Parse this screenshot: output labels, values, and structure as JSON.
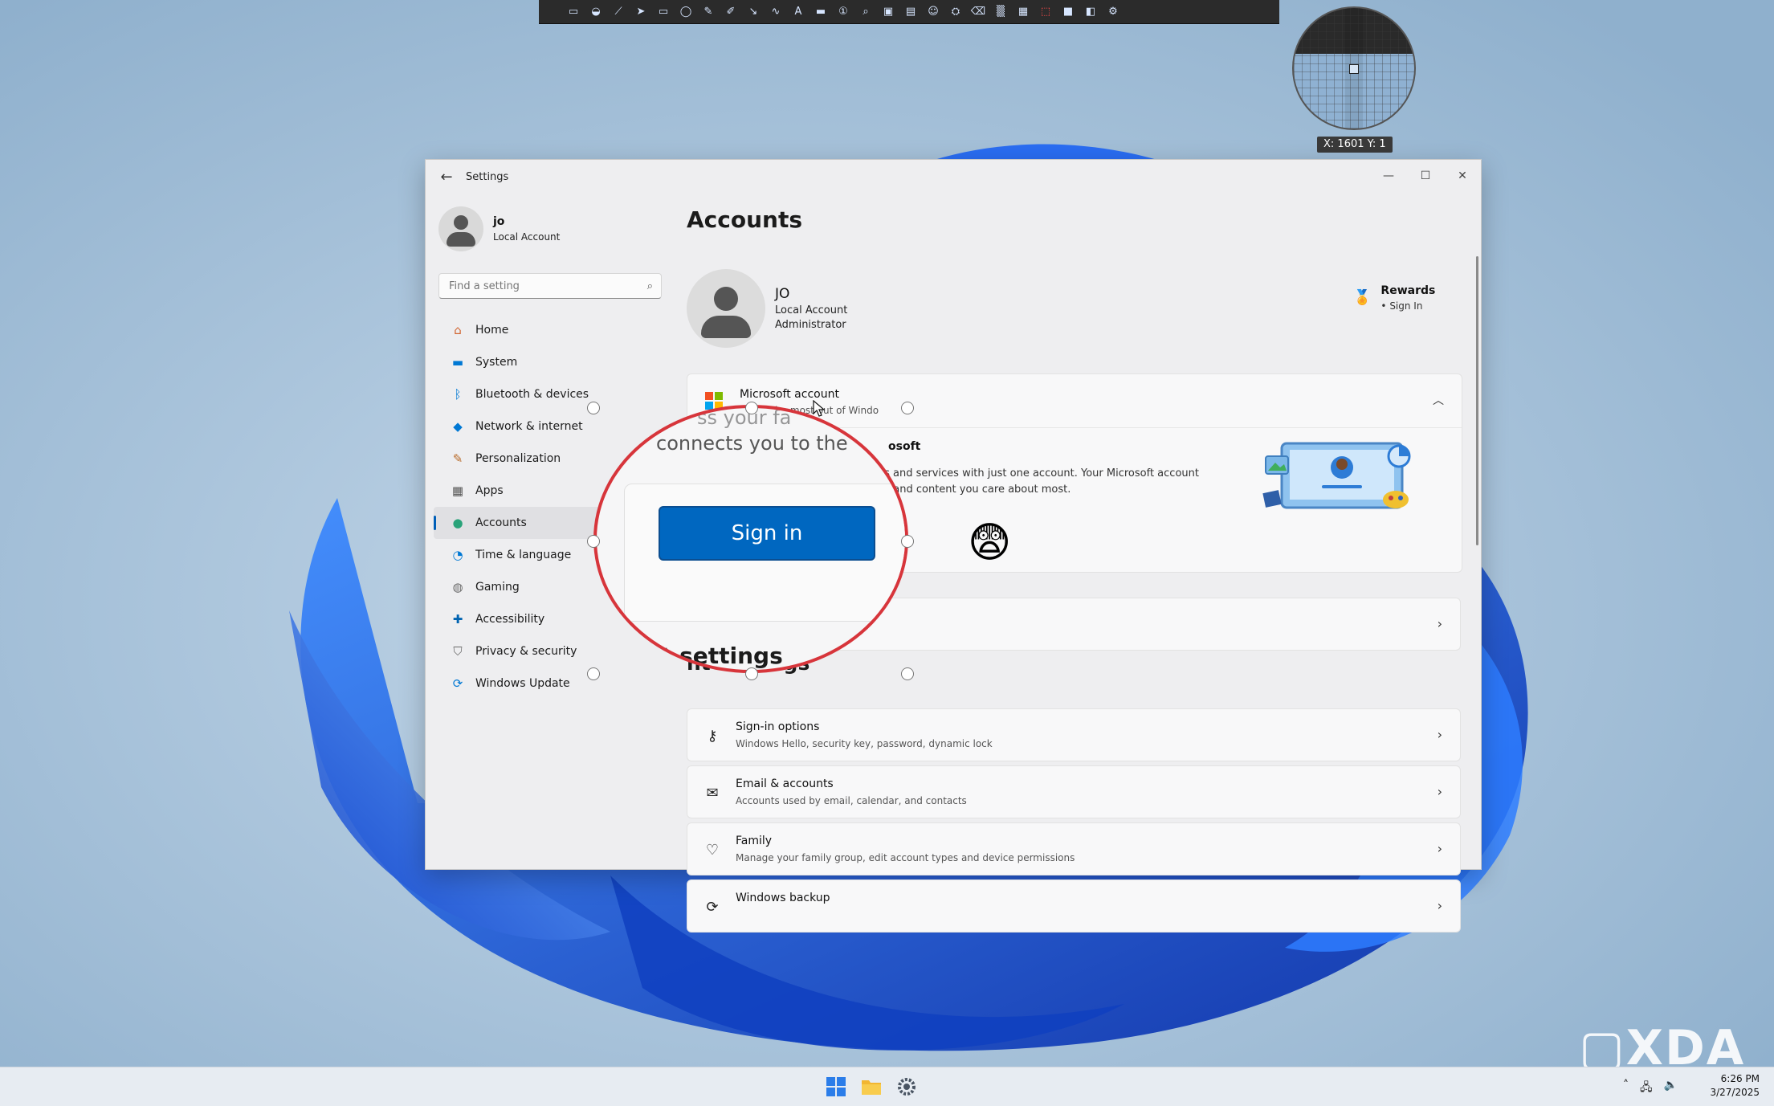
{
  "toolbar": {
    "icons": [
      "select",
      "shape",
      "line",
      "cursor",
      "rect",
      "ellipse",
      "pen",
      "marker",
      "arrow",
      "curve",
      "text",
      "callout",
      "counter",
      "magnifier",
      "note",
      "highlight",
      "emoji",
      "stamp",
      "eraser",
      "blur",
      "grid",
      "crop",
      "fill",
      "color",
      "settings"
    ]
  },
  "loupe": {
    "coordinates": "X: 1601 Y: 1"
  },
  "window": {
    "title": "Settings"
  },
  "profile": {
    "name": "jo",
    "type": "Local Account"
  },
  "search": {
    "placeholder": "Find a setting"
  },
  "nav": {
    "items": [
      {
        "label": "Home",
        "icon": "home-icon",
        "color": "#d1642f"
      },
      {
        "label": "System",
        "icon": "monitor-icon",
        "color": "#0078d4"
      },
      {
        "label": "Bluetooth & devices",
        "icon": "bluetooth-icon",
        "color": "#0078d4"
      },
      {
        "label": "Network & internet",
        "icon": "wifi-icon",
        "color": "#0078d4"
      },
      {
        "label": "Personalization",
        "icon": "brush-icon",
        "color": "#b86a28"
      },
      {
        "label": "Apps",
        "icon": "apps-icon",
        "color": "#555555"
      },
      {
        "label": "Accounts",
        "icon": "person-icon",
        "color": "#2aa37a"
      },
      {
        "label": "Time & language",
        "icon": "globe-clock-icon",
        "color": "#0078d4"
      },
      {
        "label": "Gaming",
        "icon": "controller-icon",
        "color": "#6b6b6b"
      },
      {
        "label": "Accessibility",
        "icon": "accessibility-icon",
        "color": "#0063b1"
      },
      {
        "label": "Privacy & security",
        "icon": "shield-icon",
        "color": "#6b6b6b"
      },
      {
        "label": "Windows Update",
        "icon": "update-icon",
        "color": "#0078d4"
      }
    ],
    "active": "Accounts"
  },
  "main": {
    "title": "Accounts",
    "account": {
      "name": "JO",
      "line1": "Local Account",
      "line2": "Administrator"
    },
    "rewards": {
      "title": "Rewards",
      "sub": "• Sign In"
    },
    "microsoft_account": {
      "title": "Microsoft account",
      "sub_visible": "to get the most out of Windo",
      "body_title_visible": "osoft",
      "body_line1": "ts and services with just one account. Your Microsoft account",
      "body_line2": "e, and content you care about most."
    },
    "section_heading_visible": "nt settings",
    "rows": [
      {
        "title": "Sign-in options",
        "desc": "Windows Hello, security key, password, dynamic lock",
        "icon": "key-icon"
      },
      {
        "title": "Email & accounts",
        "desc": "Accounts used by email, calendar, and contacts",
        "icon": "mail-icon"
      },
      {
        "title": "Family",
        "desc": "Manage your family group, edit account types and device permissions",
        "icon": "family-heart-icon"
      },
      {
        "title": "Windows backup",
        "desc": "",
        "icon": "backup-icon"
      }
    ]
  },
  "lens": {
    "text_top": "ss your fa",
    "text_main": "connects you to the",
    "signin_label": "Sign in",
    "heading": "nt settings"
  },
  "taskbar": {
    "time": "6:26 PM",
    "date": "3/27/2025"
  },
  "colors": {
    "accent": "#005fb8",
    "signin_button": "#0067c0",
    "lens_border": "#d7353b"
  }
}
